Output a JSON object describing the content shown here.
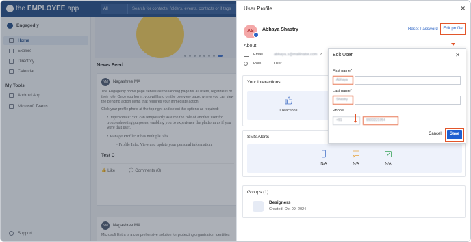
{
  "app": {
    "logo_prefix": "the",
    "logo_brand": "EMPLOYEE",
    "logo_suffix": "app",
    "search_scope": "All",
    "search_placeholder": "Search for contacts, folders, events, contacts or if tags"
  },
  "sidebar": {
    "org_name": "Engagedly",
    "items": [
      {
        "label": "Home",
        "icon": "home-icon",
        "active": true
      },
      {
        "label": "Explore",
        "icon": "explore-icon",
        "active": false
      },
      {
        "label": "Directory",
        "icon": "directory-icon",
        "active": false
      },
      {
        "label": "Calendar",
        "icon": "calendar-icon",
        "active": false
      }
    ],
    "tools_title": "My Tools",
    "tools": [
      {
        "label": "Android App",
        "icon": "android-icon"
      },
      {
        "label": "Microsoft Teams",
        "icon": "teams-icon"
      }
    ],
    "support_label": "Support"
  },
  "feed": {
    "title": "News Feed",
    "post1": {
      "author": "Nagashree MA",
      "initials": "NM",
      "para1": "The Engagedly home page serves as the landing page for all users, regardless of their role. Once you log in, you will land on the overview page, where you can view the pending action items that requires your immediate action.",
      "para2": "Click your profile photo at the top right and select the options as required:",
      "bullet1": "Impersonate: You can temporarily assume the role of another user for troubleshooting purposes, enabling you to experience the platform as if you were that user.",
      "bullet2": "Manage Profile: It has multiple tabs.",
      "sub_bullet": "Profile Info: View and update your personal information.",
      "footer_title": "Test C",
      "like": "Like",
      "comments": "Comments (0)"
    },
    "post2": {
      "author": "Nagashree MA",
      "initials": "NM",
      "text": "Microsoft Entra is a comprehensive solution for protecting organization identities"
    }
  },
  "profile": {
    "title": "User Profile",
    "initials": "AS",
    "name": "Abhaya Shastry",
    "reset_password": "Reset Password",
    "edit_profile": "Edit profile",
    "about_title": "About",
    "email_label": "Email",
    "email_value": "abhaya.s@mailinator.com",
    "role_label": "Role",
    "role_value": "User",
    "interactions_title": "Your Interactions",
    "reactions": "1 reactions",
    "sms_title": "SMS Alerts",
    "sms_values": [
      "N/A",
      "N/A",
      "N/A"
    ],
    "groups_title": "Groups",
    "groups_count": "(1)",
    "group_name": "Designers",
    "group_created": "Created: Oct 09, 2024"
  },
  "dialog": {
    "title": "Edit User",
    "first_name_label": "First name*",
    "first_name_value": "Abhaya",
    "last_name_label": "Last name*",
    "last_name_value": "Shastry",
    "phone_label": "Phone",
    "country_code": "+91",
    "phone_value": "9900221954",
    "cancel": "Cancel",
    "save": "Save"
  },
  "colors": {
    "brand": "#0d3b7a",
    "accent": "#2962c4",
    "highlight": "#e2562b",
    "save_button": "#1f5fd0"
  }
}
